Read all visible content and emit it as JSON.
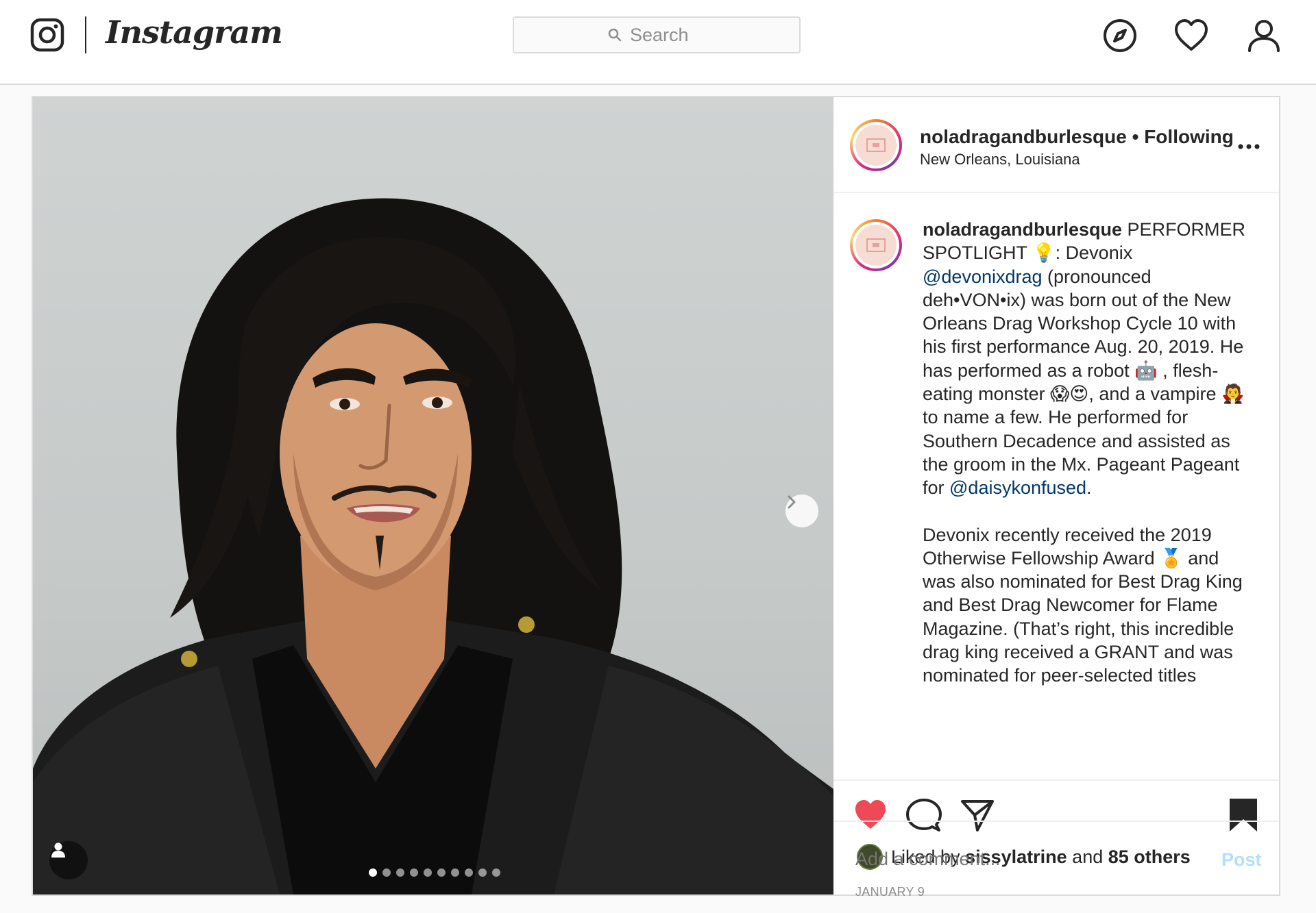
{
  "nav": {
    "wordmark": "Instagram",
    "search_placeholder": "Search",
    "icons": [
      "instagram-glyph-icon",
      "explore-compass-icon",
      "activity-heart-icon",
      "profile-icon"
    ]
  },
  "post": {
    "carousel": {
      "total_slides": 10,
      "active_index": 0
    },
    "header": {
      "username": "noladragandburlesque",
      "separator": " • ",
      "follow_status": "Following",
      "location": "New Orleans, Louisiana"
    },
    "caption": {
      "username": "noladragandburlesque",
      "p1_a": " PERFORMER SPOTLIGHT 💡: Devonix ",
      "mention1": "@devonixdrag",
      "p1_b": " (pronounced deh•VON•ix) was born out of the New Orleans Drag Workshop Cycle 10 with his first performance Aug. 20, 2019. He has performed as a robot 🤖 , flesh-eating monster 😱😍, and a vampire 🧛 to name a few. He performed for Southern Decadence and assisted as the groom in the Mx. Pageant Pageant for ",
      "mention2": "@daisykonfused",
      "p1_c": ".",
      "p2": "Devonix recently received the 2019 Otherwise Fellowship Award 🏅 and was also nominated for Best Drag King and Best Drag Newcomer for Flame Magazine. (That’s right, this incredible drag king received a GRANT and was nominated for peer-selected titles"
    },
    "likes": {
      "prefix": "Liked by ",
      "liked_by": "sissylatrine",
      "joiner": " and ",
      "others": "85 others",
      "liked": true
    },
    "date": "JANUARY 9",
    "comment": {
      "placeholder": "Add a comment...",
      "post_label": "Post"
    },
    "colors": {
      "like_red": "#ed4956",
      "link_blue": "#00376b",
      "post_disabled": "#b2dffc"
    }
  }
}
